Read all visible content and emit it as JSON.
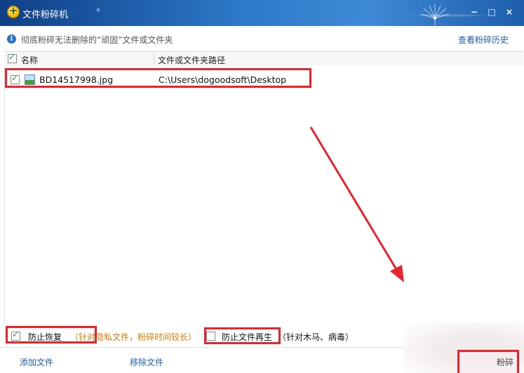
{
  "window": {
    "title": "文件粉碎机",
    "controls": {
      "minimize": "−",
      "maximize": "□",
      "close": "×"
    }
  },
  "info_bar": {
    "icon": "info-icon",
    "message": "彻底粉碎无法删除的“顽固”文件或文件夹",
    "history_link": "查看粉碎历史"
  },
  "list": {
    "columns": {
      "name": "名称",
      "path": "文件或文件夹路径"
    },
    "rows": [
      {
        "checked": true,
        "icon": "image-file-icon",
        "name": "BD14517998.jpg",
        "path": "C:\\Users\\dogoodsoft\\Desktop"
      }
    ]
  },
  "options": {
    "prevent_recovery": {
      "checked": true,
      "label": "防止恢复",
      "hint": "（针对隐私文件，粉碎时间较长）"
    },
    "prevent_regeneration": {
      "checked": false,
      "label": "防止文件再生",
      "hint": "（针对木马、病毒）"
    }
  },
  "footer": {
    "add_file": "添加文件",
    "remove_file": "移除文件",
    "shred_button": "粉碎"
  },
  "colors": {
    "titlebar": "#2d78c7",
    "link": "#1d5fb0",
    "hint_orange": "#e07b00",
    "annotation_red": "#e8242c",
    "check_green": "#2a9c2a"
  }
}
